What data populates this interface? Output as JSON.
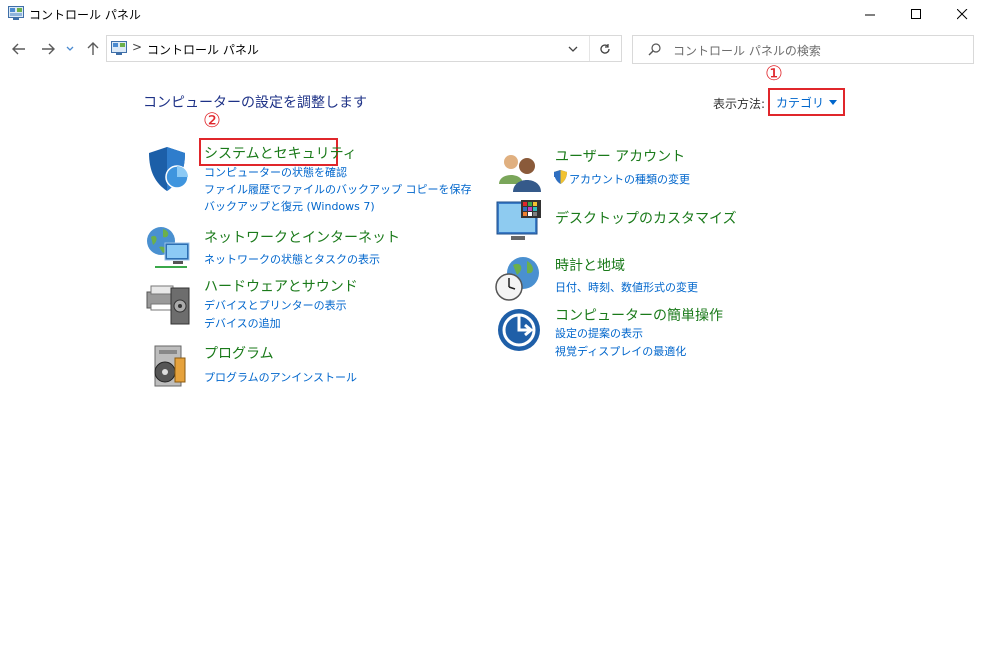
{
  "window": {
    "title": "コントロール パネル",
    "controls": {
      "minimize": "minimize",
      "maximize": "maximize",
      "close": "close"
    }
  },
  "addressbar": {
    "separator": ">",
    "path": "コントロール パネル"
  },
  "search": {
    "placeholder": "コントロール パネルの検索"
  },
  "main": {
    "heading": "コンピューターの設定を調整します",
    "view_by_label": "表示方法:",
    "view_by_value": "カテゴリ",
    "annotations": {
      "one": "①",
      "two": "②"
    }
  },
  "categories": {
    "system_security": {
      "title": "システムとセキュリティ",
      "links": [
        "コンピューターの状態を確認",
        "ファイル履歴でファイルのバックアップ コピーを保存",
        "バックアップと復元 (Windows 7)"
      ]
    },
    "network": {
      "title": "ネットワークとインターネット",
      "links": [
        "ネットワークの状態とタスクの表示"
      ]
    },
    "hardware": {
      "title": "ハードウェアとサウンド",
      "links": [
        "デバイスとプリンターの表示",
        "デバイスの追加"
      ]
    },
    "programs": {
      "title": "プログラム",
      "links": [
        "プログラムのアンインストール"
      ]
    },
    "user_accounts": {
      "title": "ユーザー アカウント",
      "links": [
        "アカウントの種類の変更"
      ]
    },
    "appearance": {
      "title": "デスクトップのカスタマイズ",
      "links": []
    },
    "clock_region": {
      "title": "時計と地域",
      "links": [
        "日付、時刻、数値形式の変更"
      ]
    },
    "ease_of_access": {
      "title": "コンピューターの簡単操作",
      "links": [
        "設定の提案の表示",
        "視覚ディスプレイの最適化"
      ]
    }
  },
  "colors": {
    "accent_red": "#e0262b",
    "link_blue": "#0066cc",
    "heading_blue": "#1e3287",
    "category_green": "#1a7a1a"
  }
}
